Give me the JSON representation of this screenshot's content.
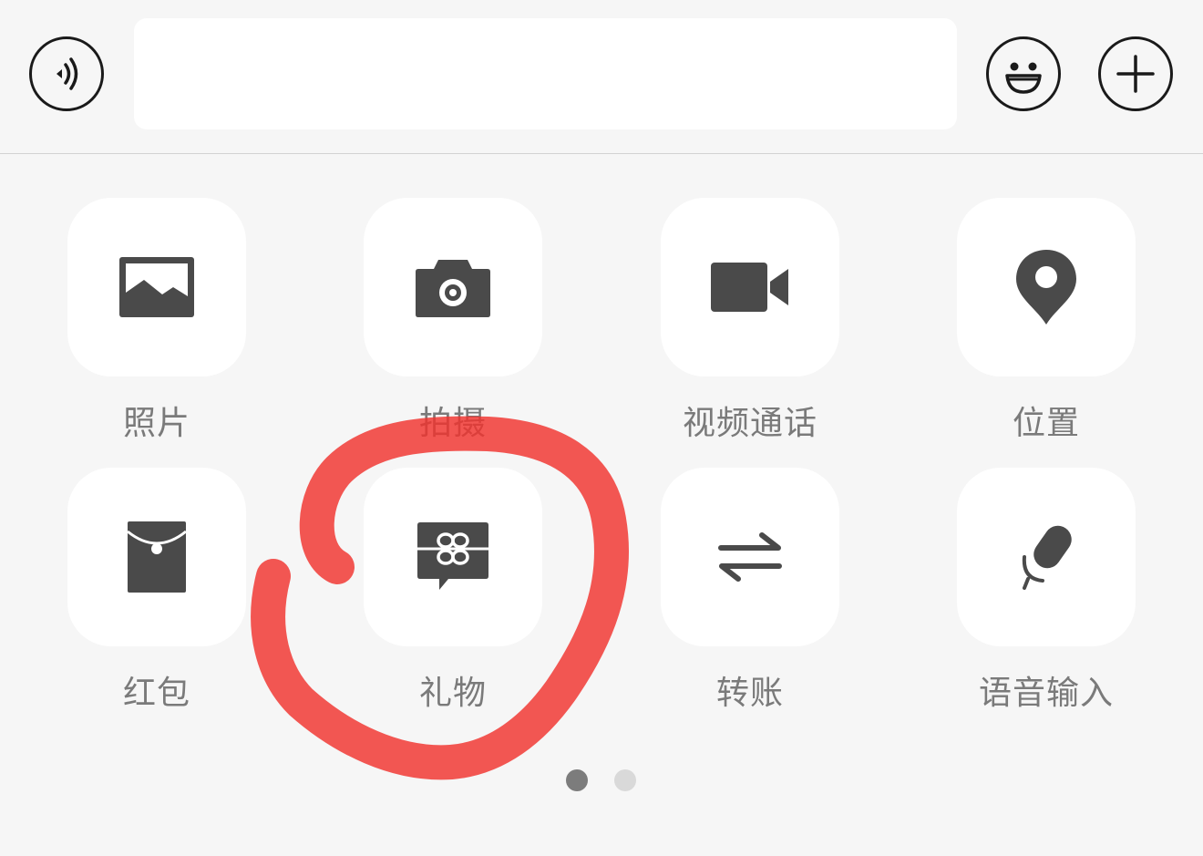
{
  "input_bar": {
    "voice_icon": "voice-wave-icon",
    "emoji_icon": "smiley-face-icon",
    "plus_icon": "plus-icon",
    "text_value": ""
  },
  "grid": {
    "items": [
      {
        "label": "照片",
        "icon": "photo-icon"
      },
      {
        "label": "拍摄",
        "icon": "camera-icon"
      },
      {
        "label": "视频通话",
        "icon": "video-call-icon"
      },
      {
        "label": "位置",
        "icon": "location-pin-icon"
      },
      {
        "label": "红包",
        "icon": "red-envelope-icon"
      },
      {
        "label": "礼物",
        "icon": "gift-icon"
      },
      {
        "label": "转账",
        "icon": "transfer-arrows-icon"
      },
      {
        "label": "语音输入",
        "icon": "microphone-icon"
      }
    ]
  },
  "pager": {
    "page_count": 2,
    "current_page": 1
  },
  "colors": {
    "background": "#f6f6f6",
    "tile": "#ffffff",
    "icon": "#4a4a4a",
    "label": "#7a7a7a",
    "annotation": "#f0322d"
  }
}
